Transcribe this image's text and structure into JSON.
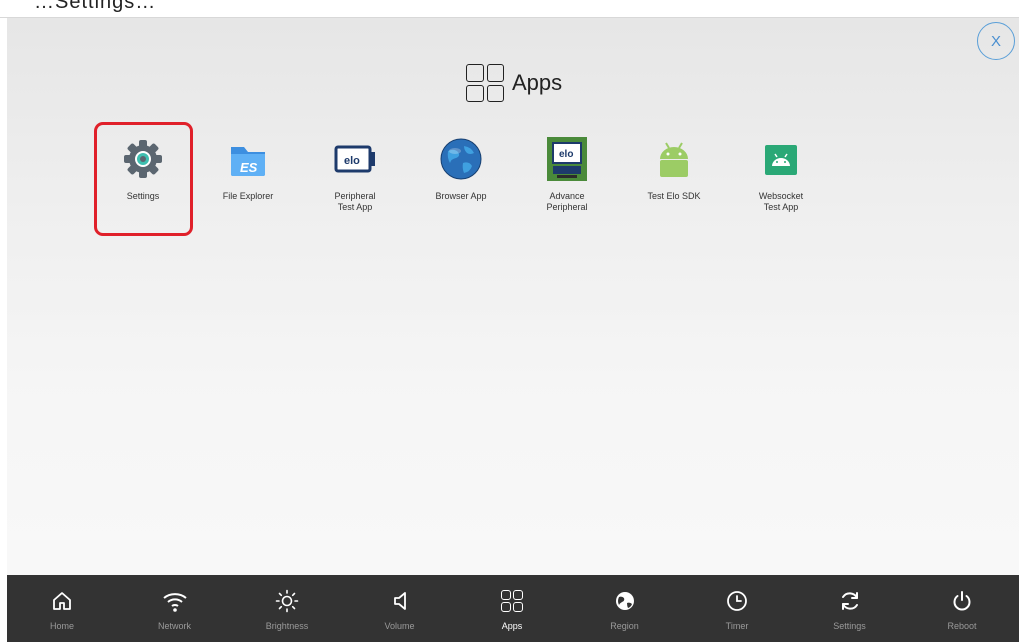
{
  "top_caption": "…Settings…",
  "close_button": {
    "label": "X"
  },
  "header": {
    "title": "Apps"
  },
  "apps": [
    {
      "label": "Settings",
      "icon": "gear-icon",
      "color": "#5b6670"
    },
    {
      "label": "File Explorer",
      "icon": "folder-icon",
      "color": "#3d8fe0"
    },
    {
      "label": "Peripheral\nTest App",
      "icon": "elo-monitor-icon",
      "color": "#1d3a6b"
    },
    {
      "label": "Browser App",
      "icon": "globe-icon",
      "color": "#2a6fb8"
    },
    {
      "label": "Advance\nPeripheral",
      "icon": "elo-peripheral-icon",
      "color": "#4a8a3a"
    },
    {
      "label": "Test Elo SDK",
      "icon": "android-icon",
      "color": "#9ccc65"
    },
    {
      "label": "Websocket\nTest App",
      "icon": "android-square-icon",
      "color": "#2aa876"
    }
  ],
  "bottom_nav": [
    {
      "label": "Home",
      "icon": "home-icon",
      "active": false
    },
    {
      "label": "Network",
      "icon": "wifi-icon",
      "active": false
    },
    {
      "label": "Brightness",
      "icon": "sun-icon",
      "active": false
    },
    {
      "label": "Volume",
      "icon": "speaker-icon",
      "active": false
    },
    {
      "label": "Apps",
      "icon": "apps-grid-icon",
      "active": true
    },
    {
      "label": "Region",
      "icon": "globe-icon",
      "active": false
    },
    {
      "label": "Timer",
      "icon": "clock-icon",
      "active": false
    },
    {
      "label": "Settings",
      "icon": "refresh-icon",
      "active": false
    },
    {
      "label": "Reboot",
      "icon": "power-icon",
      "active": false
    }
  ],
  "colors": {
    "highlight": "#e0202a",
    "nav_bg": "#333333",
    "close_accent": "#4a8fd0"
  }
}
